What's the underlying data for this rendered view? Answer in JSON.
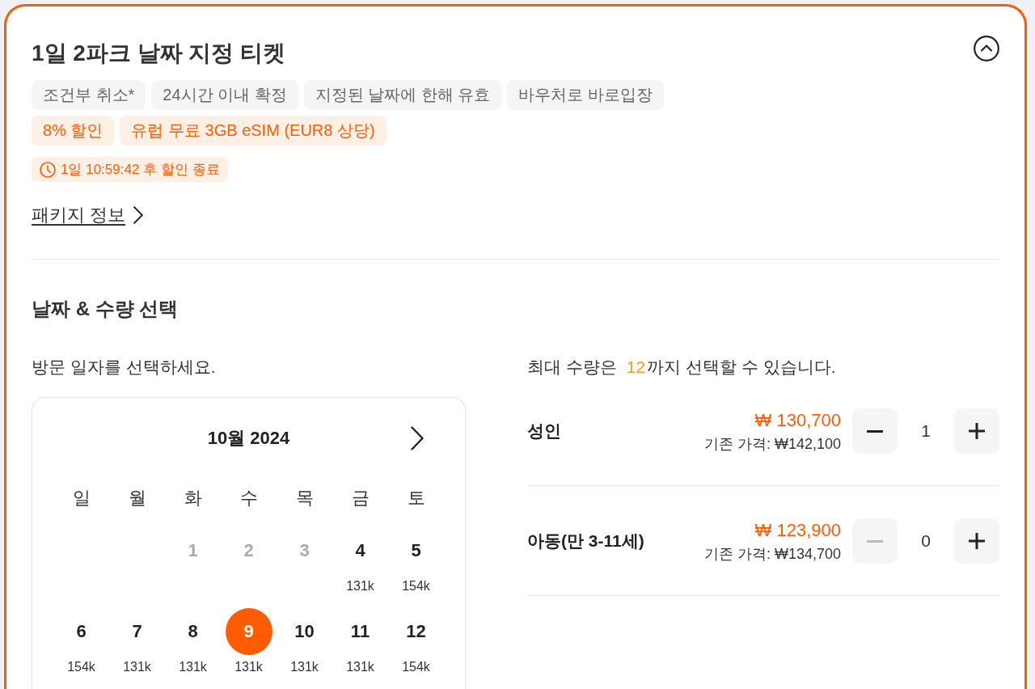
{
  "product": {
    "title": "1일 2파크 날짜 지정 티켓",
    "expanded": true,
    "feature_tags": [
      "조건부 취소*",
      "24시간 이내 확정",
      "지정된 날짜에 한해 유효",
      "바우처로 바로입장"
    ],
    "promo_tags": [
      "8% 할인",
      "유럽 무료 3GB eSIM (EUR8 상당)"
    ],
    "countdown": "1일 10:59:42 후 할인 종료",
    "package_link": "패키지 정보"
  },
  "date_quantity": {
    "title": "날짜 & 수량 선택",
    "calendar": {
      "prompt": "방문 일자를 선택하세요.",
      "month": "10월 2024",
      "weekdays": [
        "일",
        "월",
        "화",
        "수",
        "목",
        "금",
        "토"
      ],
      "weeks": [
        [
          {
            "day": "1",
            "disabled": true,
            "selected": false
          },
          {
            "day": "2",
            "disabled": true,
            "selected": false
          },
          {
            "day": "3",
            "disabled": true,
            "selected": false
          },
          {
            "day": "4",
            "price": "131k",
            "disabled": false,
            "selected": false
          },
          {
            "day": "5",
            "price": "154k",
            "disabled": false,
            "selected": false
          }
        ],
        [
          {
            "day": "6",
            "price": "154k",
            "disabled": false,
            "selected": false
          },
          {
            "day": "7",
            "price": "131k",
            "disabled": false,
            "selected": false
          },
          {
            "day": "8",
            "price": "131k",
            "disabled": false,
            "selected": false
          },
          {
            "day": "9",
            "price": "131k",
            "disabled": false,
            "selected": true
          },
          {
            "day": "10",
            "price": "131k",
            "disabled": false,
            "selected": false
          },
          {
            "day": "11",
            "price": "131k",
            "disabled": false,
            "selected": false
          },
          {
            "day": "12",
            "price": "154k",
            "disabled": false,
            "selected": false
          }
        ]
      ]
    },
    "quantity": {
      "note": {
        "before": "최대 수량은",
        "max": "12",
        "after": "까지 선택할 수 있습니다."
      },
      "items": [
        {
          "label": "성인",
          "price": "₩ 130,700",
          "original_price": "기존 가격: ₩142,100",
          "count": "1",
          "decrement_disabled": false
        },
        {
          "label": "아동(만 3-11세)",
          "price": "₩ 123,900",
          "original_price": "기존 가격: ₩134,700",
          "count": "0",
          "decrement_disabled": true
        }
      ]
    }
  }
}
